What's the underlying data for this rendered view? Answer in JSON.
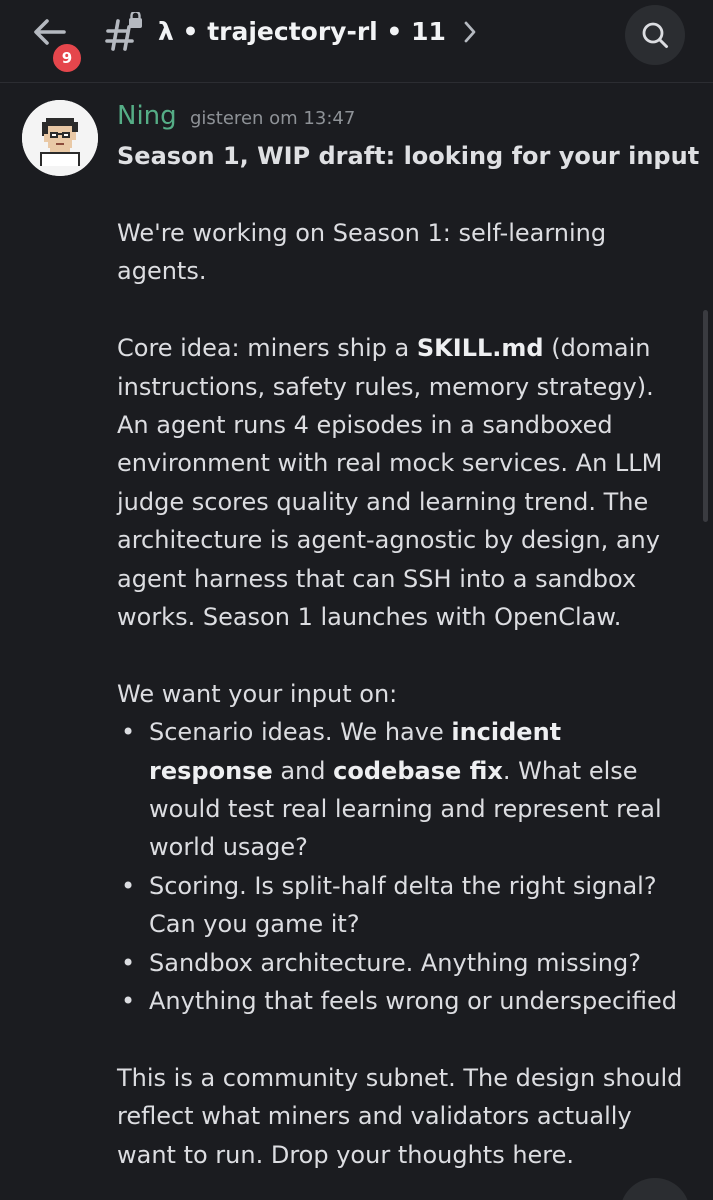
{
  "header": {
    "badge_count": "9",
    "channel_title": "λ • trajectory-rl • 11"
  },
  "message": {
    "author": "Ning",
    "timestamp": "gisteren om 13:47",
    "title": "Season 1, WIP draft: looking for your input",
    "p1": "We're working on Season 1: self-learning agents.",
    "p2_pre": "Core idea: miners ship a ",
    "p2_bold": "SKILL.md",
    "p2_post": " (domain instructions, safety rules, memory strategy). An agent runs 4 episodes in a sandboxed environment with real mock services. An LLM judge scores quality and learning trend. The architecture is agent-agnostic by design, any agent harness that can SSH into a sandbox works. Season 1 launches with OpenClaw.",
    "p3": "We want your input on:",
    "bullet1_pre": "Scenario ideas. We have ",
    "bullet1_bold1": "incident response",
    "bullet1_mid": " and ",
    "bullet1_bold2": "codebase fix",
    "bullet1_post": ". What else would test real learning and represent real world usage?",
    "bullet2": "Scoring. Is split-half delta the right signal? Can you game it?",
    "bullet3": "Sandbox architecture. Anything missing?",
    "bullet4": "Anything that feels wrong or underspecified",
    "p4": "This is a community subnet. The design should reflect what miners and validators actually want to run. Drop your thoughts here."
  },
  "icons": {
    "back": "arrow-left-icon",
    "channel": "hashtag-lock-icon",
    "chevron": "chevron-right-icon",
    "search": "search-icon"
  },
  "colors": {
    "background": "#1b1c20",
    "author": "#55ad86",
    "badge": "#e5464c",
    "text": "#dcdde1",
    "muted": "#8e9297"
  }
}
